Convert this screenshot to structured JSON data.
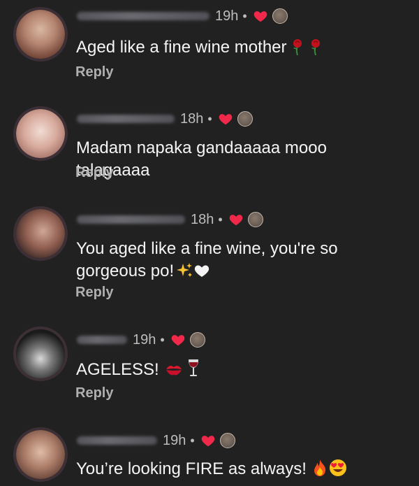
{
  "comments": [
    {
      "time": "19h",
      "dot": "•",
      "text": "Aged like a fine wine mother",
      "emojis": [
        "rose-icon",
        "rose-icon"
      ],
      "reply": "Reply",
      "avatar_colors": [
        "#c7a38e",
        "#7d4a3a"
      ]
    },
    {
      "time": "18h",
      "dot": "•",
      "text": "Madam napaka gandaaaaa mooo talagaaaa",
      "emojis": [],
      "reply": "Reply",
      "avatar_colors": [
        "#e8c9c0",
        "#b5847a"
      ]
    },
    {
      "time": "18h",
      "dot": "•",
      "text": "You aged like a fine wine, you're so gorgeous po!",
      "emojis": [
        "sparkles-icon",
        "white-heart-icon"
      ],
      "reply": "Reply",
      "avatar_colors": [
        "#b88a77",
        "#3e2a25"
      ]
    },
    {
      "time": "19h",
      "dot": "•",
      "text": "AGELESS!",
      "emojis": [
        "kiss-mark-icon",
        "wine-glass-icon"
      ],
      "reply": "Reply",
      "avatar_colors": [
        "#9a9a9a",
        "#1b1b1b"
      ]
    },
    {
      "time": "19h",
      "dot": "•",
      "text": "You’re looking FIRE as always!",
      "emojis": [
        "fire-icon",
        "heart-eyes-icon"
      ],
      "reply": "",
      "avatar_colors": [
        "#c49a83",
        "#6e4b3f"
      ]
    }
  ],
  "colors": {
    "background": "#212121",
    "heart": "#f02849"
  }
}
